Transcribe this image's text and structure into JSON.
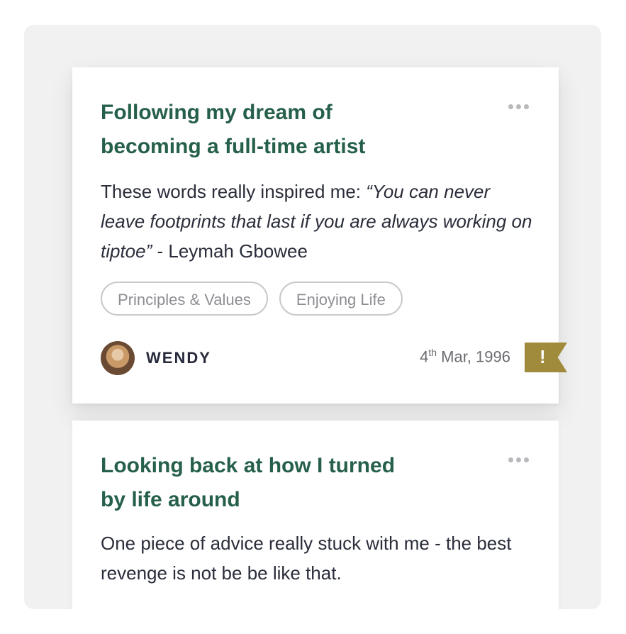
{
  "entries": [
    {
      "title": "Following my dream of becoming a full-time artist",
      "body_prefix": "These words really inspired me: ",
      "quote": "“You can never leave footprints that last if you are always working on tiptoe”",
      "body_suffix": " - Leymah Gbowee",
      "tags": [
        "Principles & Values",
        "Enjoying Life"
      ],
      "author": "WENDY",
      "date_day": "4",
      "date_suffix": "th",
      "date_rest": " Mar, 1996",
      "flag_symbol": "!"
    },
    {
      "title": "Looking back at how I turned by life around",
      "body": "One piece of advice really stuck with me - the best revenge is not be be like that."
    }
  ],
  "colors": {
    "title": "#26604a",
    "flag": "#a08a3b",
    "panel": "#f1f1f2"
  },
  "icons": {
    "more": "more-horizontal-icon",
    "flag": "exclamation-flag-icon"
  }
}
